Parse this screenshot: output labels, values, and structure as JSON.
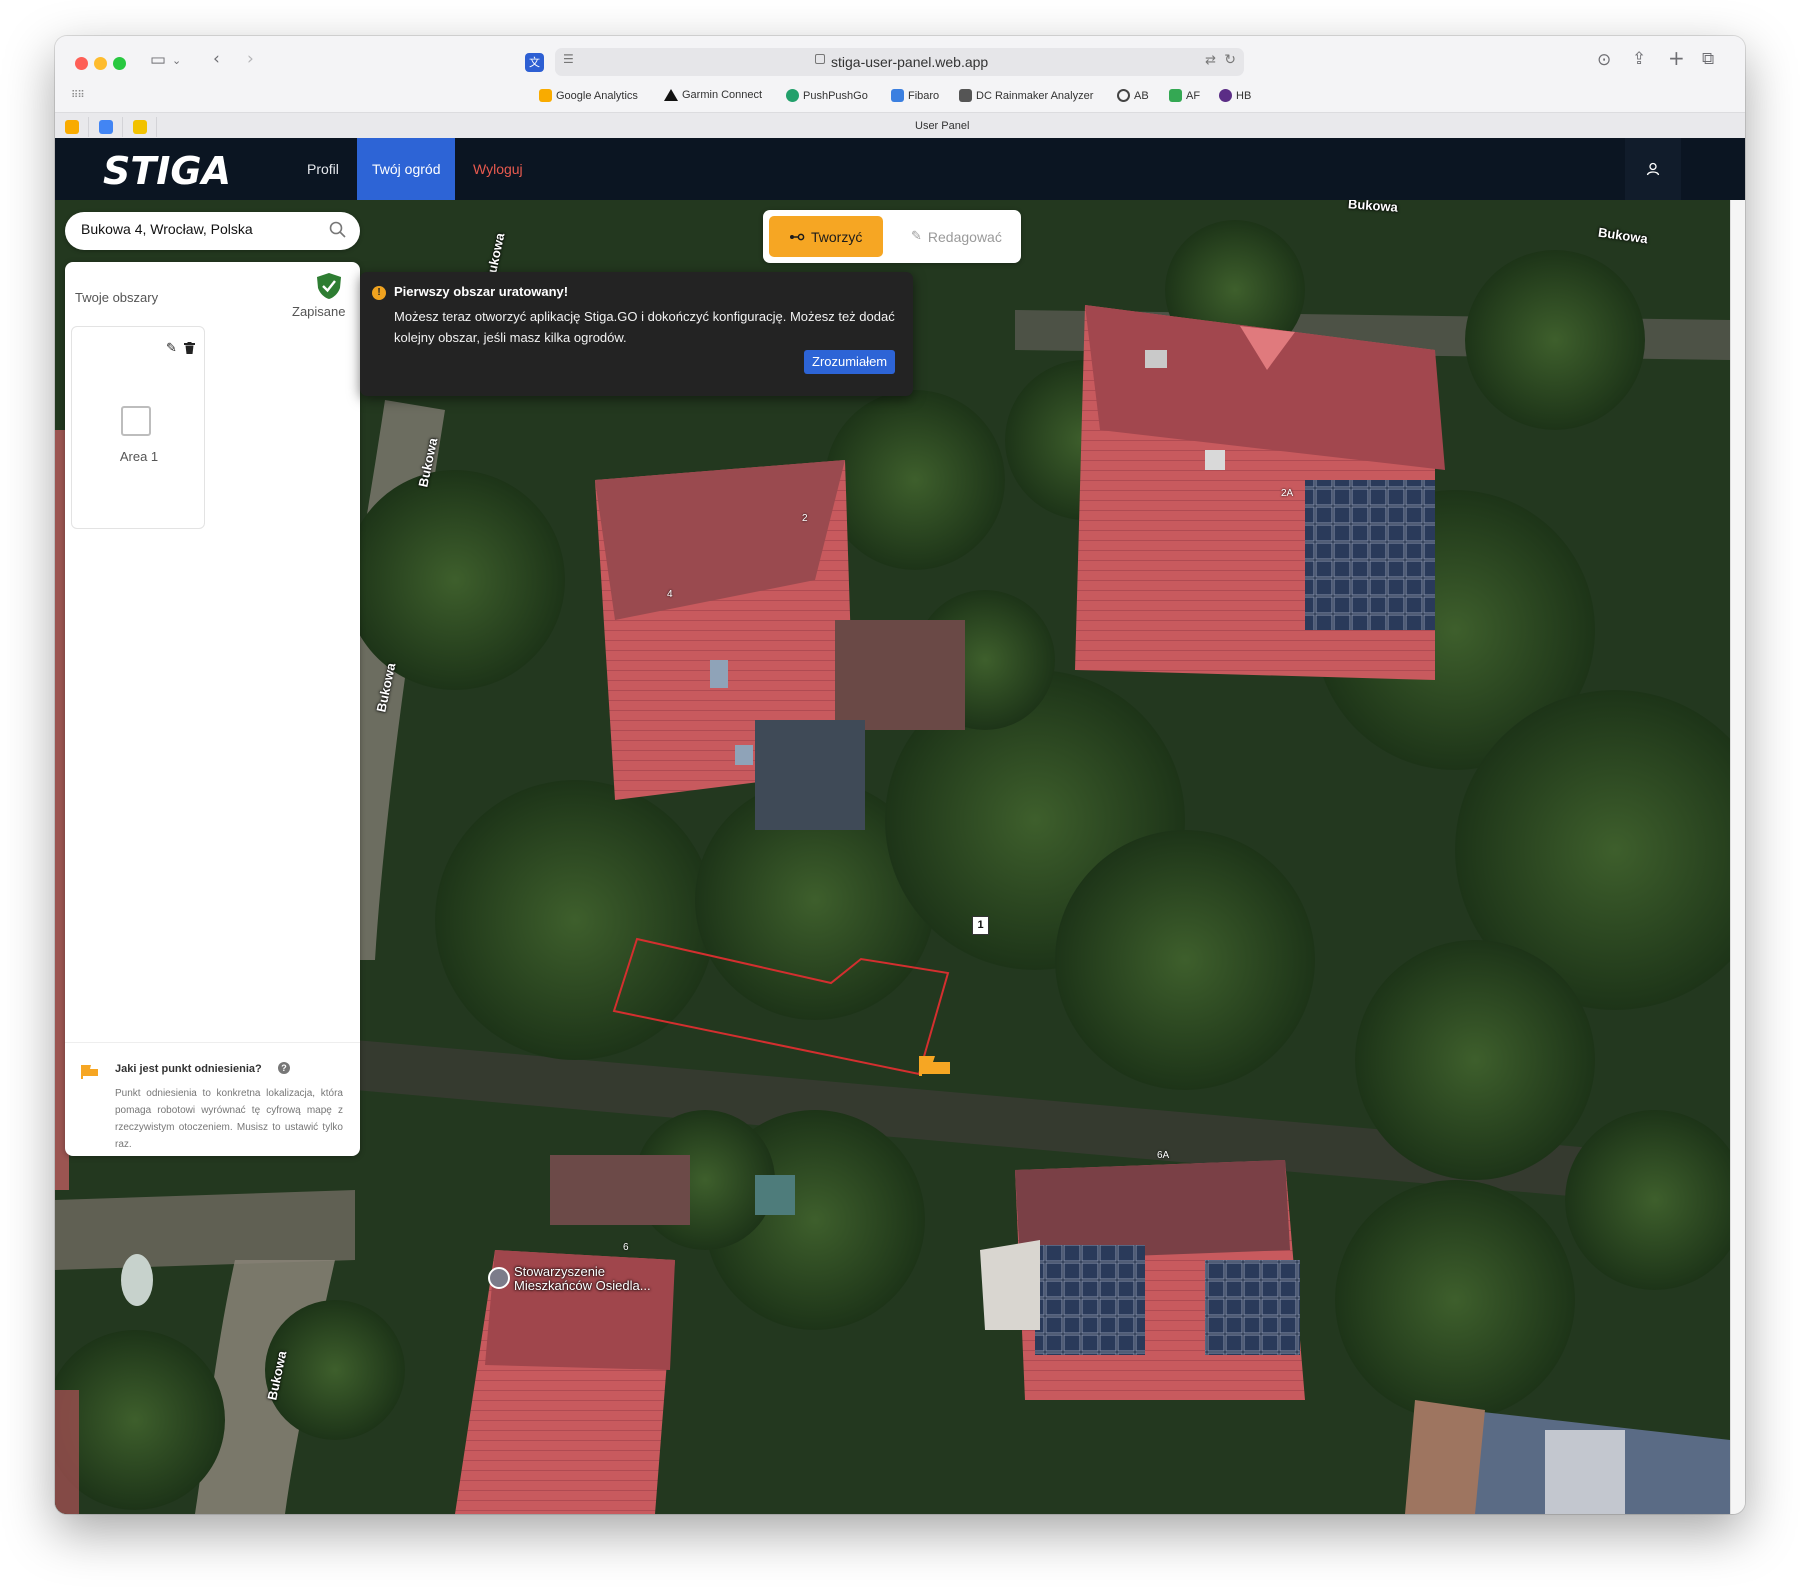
{
  "browser": {
    "url": "stiga-user-panel.web.app",
    "tab_title": "User Panel",
    "bookmarks": [
      {
        "label": "Google Analytics",
        "color": "#f9ab00"
      },
      {
        "label": "Garmin Connect",
        "color": "#111111"
      },
      {
        "label": "PushPushGo",
        "color": "#22a06b"
      },
      {
        "label": "Fibaro",
        "color": "#3b7fe0"
      },
      {
        "label": "DC Rainmaker Analyzer",
        "color": "#555555"
      },
      {
        "label": "AB",
        "color": "#444444"
      },
      {
        "label": "AF",
        "color": "#34a853"
      },
      {
        "label": "HB",
        "color": "#5b2d86"
      }
    ]
  },
  "nav": {
    "brand": "STIGA",
    "links": [
      "Profil",
      "Twój ogród",
      "Wyloguj"
    ],
    "active_link": "Twój ogród"
  },
  "search": {
    "value": "Bukowa 4, Wrocław, Polska"
  },
  "areas_panel": {
    "title": "Twoje obszary",
    "status": "Zapisane",
    "areas": [
      {
        "name": "Area 1"
      }
    ]
  },
  "reference_info": {
    "title": "Jaki jest punkt odniesienia?",
    "text": "Punkt odniesienia to konkretna lokalizacja, która pomaga robotowi wyrównać tę cyfrową mapę z rzeczywistym otoczeniem. Musisz to ustawić tylko raz."
  },
  "mode_toggle": {
    "create": "Tworzyć",
    "edit": "Redagować",
    "active": "create"
  },
  "toast": {
    "title": "Pierwszy obszar uratowany!",
    "text": "Możesz teraz otworzyć aplikację Stiga.GO i dokończyć konfigurację. Możesz też dodać kolejny obszar, jeśli masz kilka ogrodów.",
    "button": "Zrozumiałem"
  },
  "map": {
    "street_labels": [
      "Bukowa",
      "Bukowa",
      "Bukowa",
      "Bukowa",
      "Bukowa",
      "Bukowa"
    ],
    "house_numbers": [
      "2",
      "4",
      "2A",
      "6A",
      "6",
      "1"
    ],
    "poi": "Stowarzyszenie Mieszkańców Osiedla...",
    "area_marker": "1"
  },
  "colors": {
    "nav_bg": "#0b1522",
    "accent_blue": "#2d64d6",
    "create_orange": "#f6a623",
    "logout_red": "#e85a4f",
    "area_outline": "#d32f2f",
    "saved_green": "#2e7d32"
  }
}
